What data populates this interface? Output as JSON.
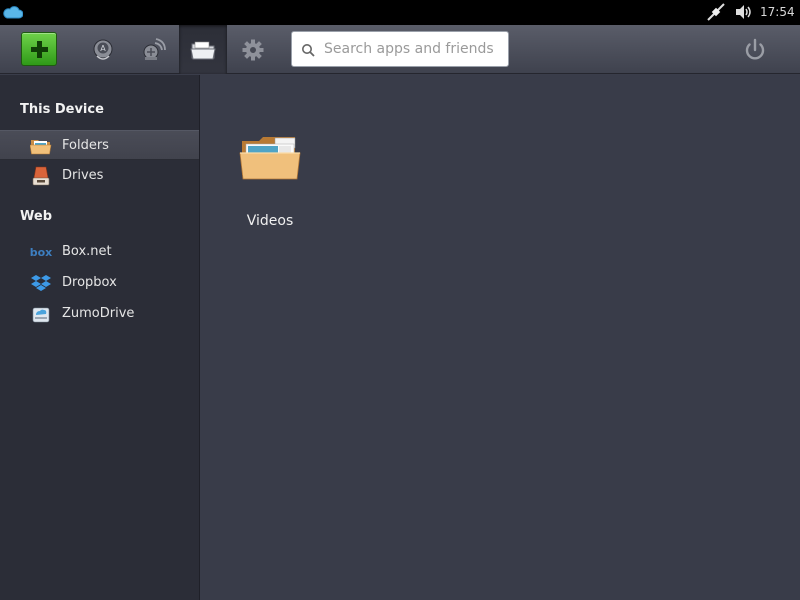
{
  "system_bar": {
    "clock": "17:54",
    "icons": [
      "cloud-icon",
      "network-plug-icon",
      "volume-icon"
    ]
  },
  "toolbar": {
    "add_icon": "plus-icon",
    "nav_icons": [
      "apps-icon",
      "social-icon",
      "folders-icon",
      "settings-icon"
    ],
    "active_nav": "folders-icon",
    "search_placeholder": "Search apps and friends",
    "search_value": "",
    "power_icon": "power-icon",
    "accent_color": "#3fae22"
  },
  "sidebar": {
    "sections": [
      {
        "title": "This Device",
        "items": [
          {
            "label": "Folders",
            "icon": "folder-icon",
            "selected": true
          },
          {
            "label": "Drives",
            "icon": "drive-icon",
            "selected": false
          }
        ]
      },
      {
        "title": "Web",
        "items": [
          {
            "label": "Box.net",
            "icon": "box-net-icon",
            "selected": false
          },
          {
            "label": "Dropbox",
            "icon": "dropbox-icon",
            "selected": false
          },
          {
            "label": "ZumoDrive",
            "icon": "zumodrive-icon",
            "selected": false
          }
        ]
      }
    ]
  },
  "main": {
    "folders": [
      {
        "name": "Videos",
        "icon": "video-folder-icon"
      }
    ]
  }
}
